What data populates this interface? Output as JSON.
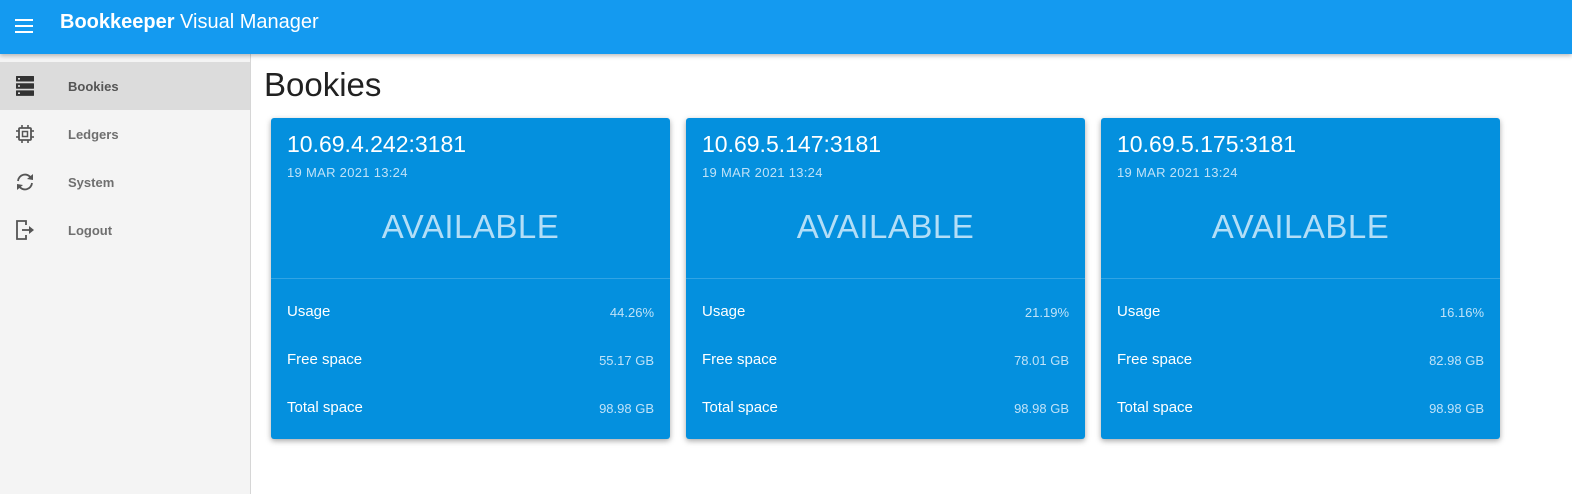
{
  "app": {
    "title_bold": "Bookkeeper",
    "title_rest": " Visual Manager"
  },
  "sidebar": {
    "items": [
      {
        "label": "Bookies",
        "icon": "server-icon",
        "active": true
      },
      {
        "label": "Ledgers",
        "icon": "chip-icon",
        "active": false
      },
      {
        "label": "System",
        "icon": "sync-icon",
        "active": false
      },
      {
        "label": "Logout",
        "icon": "logout-icon",
        "active": false
      }
    ]
  },
  "page": {
    "title": "Bookies"
  },
  "bookies": [
    {
      "host": "10.69.4.242:3181",
      "date": "19 MAR 2021 13:24",
      "status": "AVAILABLE",
      "usage_label": "Usage",
      "usage": "44.26%",
      "free_label": "Free space",
      "free": "55.17 GB",
      "total_label": "Total space",
      "total": "98.98 GB"
    },
    {
      "host": "10.69.5.147:3181",
      "date": "19 MAR 2021 13:24",
      "status": "AVAILABLE",
      "usage_label": "Usage",
      "usage": "21.19%",
      "free_label": "Free space",
      "free": "78.01 GB",
      "total_label": "Total space",
      "total": "98.98 GB"
    },
    {
      "host": "10.69.5.175:3181",
      "date": "19 MAR 2021 13:24",
      "status": "AVAILABLE",
      "usage_label": "Usage",
      "usage": "16.16%",
      "free_label": "Free space",
      "free": "82.98 GB",
      "total_label": "Total space",
      "total": "98.98 GB"
    }
  ],
  "colors": {
    "appbar": "#149af0",
    "card": "#0490de",
    "sidebar": "#f4f4f4",
    "sidebar_active": "#dcdcdc"
  }
}
